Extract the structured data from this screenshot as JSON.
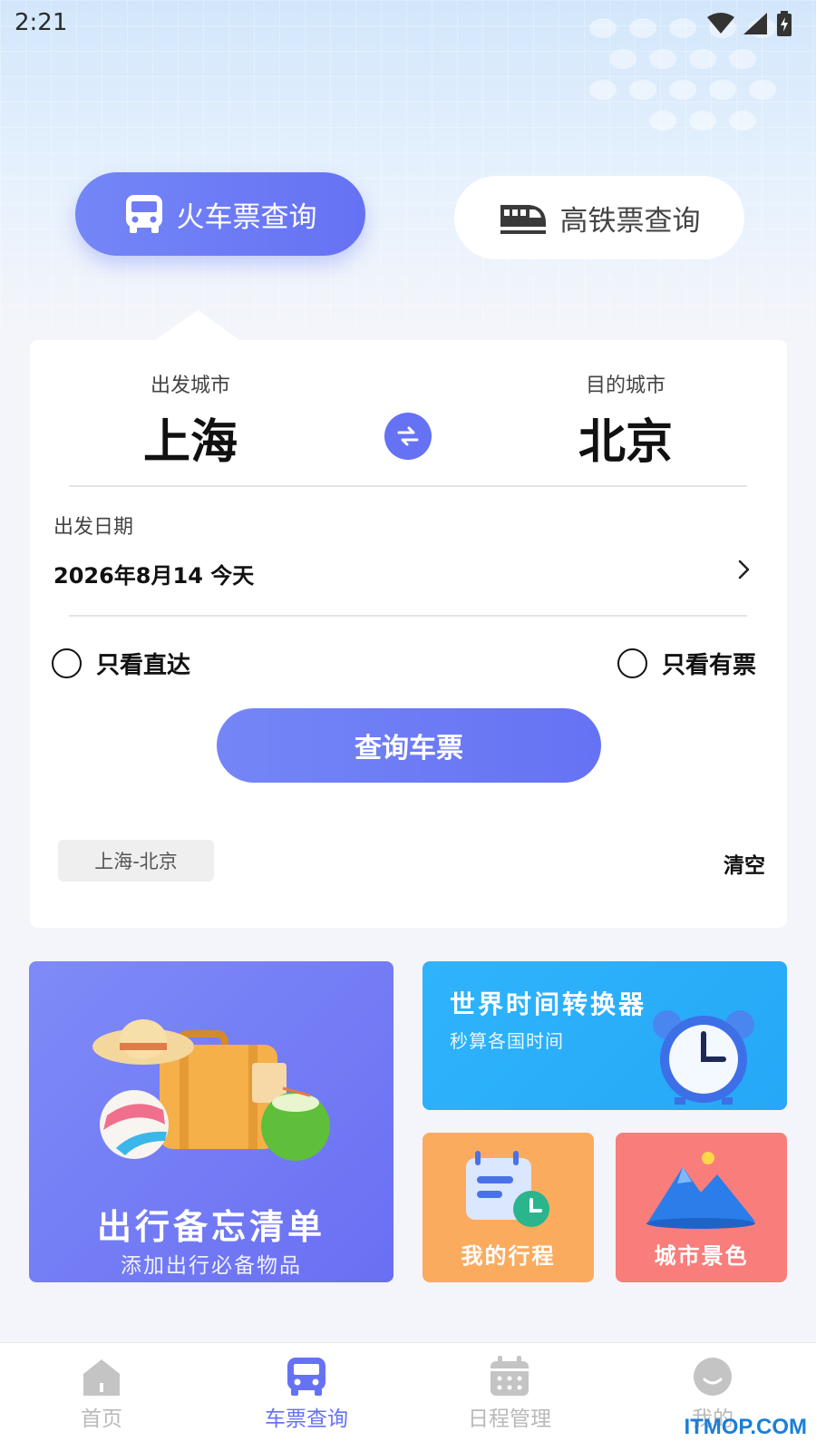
{
  "status_bar": {
    "time": "2:21"
  },
  "mode_tabs": {
    "train": {
      "label": "火车票查询",
      "active": true
    },
    "high_speed": {
      "label": "高铁票查询",
      "active": false
    }
  },
  "search": {
    "from_label": "出发城市",
    "from_city": "上海",
    "to_label": "目的城市",
    "to_city": "北京",
    "date_label": "出发日期",
    "date_value": "2026年8月14 今天",
    "direct_only_label": "只看直达",
    "direct_only_checked": false,
    "available_only_label": "只看有票",
    "available_only_checked": false,
    "search_button": "查询车票",
    "history": [
      "上海-北京"
    ],
    "clear_label": "清空"
  },
  "tiles": {
    "checklist": {
      "title": "出行备忘清单",
      "subtitle": "添加出行必备物品"
    },
    "world_clock": {
      "title": "世界时间转换器",
      "subtitle": "秒算各国时间"
    },
    "my_trips": {
      "title": "我的行程"
    },
    "city_scenery": {
      "title": "城市景色"
    }
  },
  "bottom_nav": {
    "items": [
      {
        "label": "首页",
        "icon": "home-icon",
        "active": false
      },
      {
        "label": "车票查询",
        "icon": "bus-icon",
        "active": true
      },
      {
        "label": "日程管理",
        "icon": "calendar-icon",
        "active": false
      },
      {
        "label": "我的",
        "icon": "profile-icon",
        "active": false
      }
    ]
  },
  "watermark": "ITMOP.COM",
  "colors": {
    "accent": "#6672f4",
    "clock_tile": "#2fb4fb",
    "trip_tile": "#fbab5e",
    "scenery_tile": "#f97d7a"
  }
}
